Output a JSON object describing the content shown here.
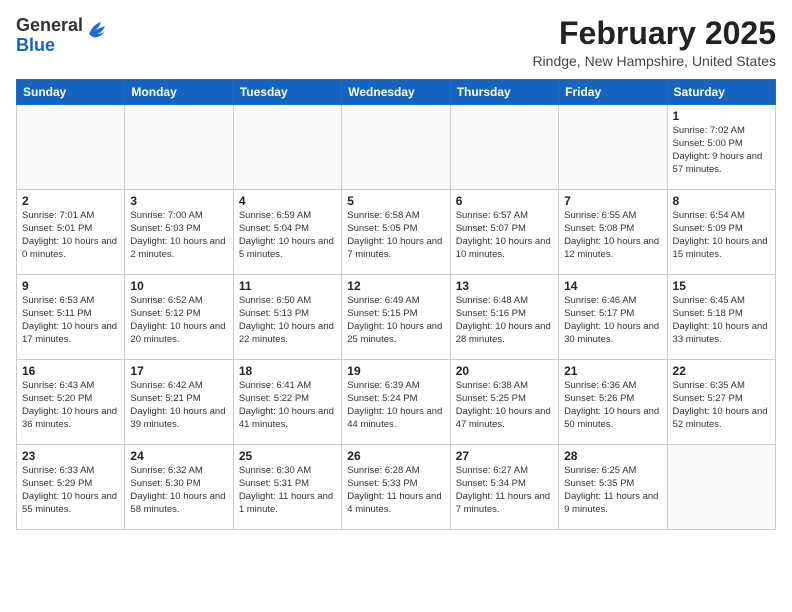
{
  "header": {
    "logo_general": "General",
    "logo_blue": "Blue",
    "month_year": "February 2025",
    "location": "Rindge, New Hampshire, United States"
  },
  "calendar": {
    "days_of_week": [
      "Sunday",
      "Monday",
      "Tuesday",
      "Wednesday",
      "Thursday",
      "Friday",
      "Saturday"
    ],
    "weeks": [
      [
        {
          "day": "",
          "info": ""
        },
        {
          "day": "",
          "info": ""
        },
        {
          "day": "",
          "info": ""
        },
        {
          "day": "",
          "info": ""
        },
        {
          "day": "",
          "info": ""
        },
        {
          "day": "",
          "info": ""
        },
        {
          "day": "1",
          "info": "Sunrise: 7:02 AM\nSunset: 5:00 PM\nDaylight: 9 hours and 57 minutes."
        }
      ],
      [
        {
          "day": "2",
          "info": "Sunrise: 7:01 AM\nSunset: 5:01 PM\nDaylight: 10 hours and 0 minutes."
        },
        {
          "day": "3",
          "info": "Sunrise: 7:00 AM\nSunset: 5:03 PM\nDaylight: 10 hours and 2 minutes."
        },
        {
          "day": "4",
          "info": "Sunrise: 6:59 AM\nSunset: 5:04 PM\nDaylight: 10 hours and 5 minutes."
        },
        {
          "day": "5",
          "info": "Sunrise: 6:58 AM\nSunset: 5:05 PM\nDaylight: 10 hours and 7 minutes."
        },
        {
          "day": "6",
          "info": "Sunrise: 6:57 AM\nSunset: 5:07 PM\nDaylight: 10 hours and 10 minutes."
        },
        {
          "day": "7",
          "info": "Sunrise: 6:55 AM\nSunset: 5:08 PM\nDaylight: 10 hours and 12 minutes."
        },
        {
          "day": "8",
          "info": "Sunrise: 6:54 AM\nSunset: 5:09 PM\nDaylight: 10 hours and 15 minutes."
        }
      ],
      [
        {
          "day": "9",
          "info": "Sunrise: 6:53 AM\nSunset: 5:11 PM\nDaylight: 10 hours and 17 minutes."
        },
        {
          "day": "10",
          "info": "Sunrise: 6:52 AM\nSunset: 5:12 PM\nDaylight: 10 hours and 20 minutes."
        },
        {
          "day": "11",
          "info": "Sunrise: 6:50 AM\nSunset: 5:13 PM\nDaylight: 10 hours and 22 minutes."
        },
        {
          "day": "12",
          "info": "Sunrise: 6:49 AM\nSunset: 5:15 PM\nDaylight: 10 hours and 25 minutes."
        },
        {
          "day": "13",
          "info": "Sunrise: 6:48 AM\nSunset: 5:16 PM\nDaylight: 10 hours and 28 minutes."
        },
        {
          "day": "14",
          "info": "Sunrise: 6:46 AM\nSunset: 5:17 PM\nDaylight: 10 hours and 30 minutes."
        },
        {
          "day": "15",
          "info": "Sunrise: 6:45 AM\nSunset: 5:18 PM\nDaylight: 10 hours and 33 minutes."
        }
      ],
      [
        {
          "day": "16",
          "info": "Sunrise: 6:43 AM\nSunset: 5:20 PM\nDaylight: 10 hours and 36 minutes."
        },
        {
          "day": "17",
          "info": "Sunrise: 6:42 AM\nSunset: 5:21 PM\nDaylight: 10 hours and 39 minutes."
        },
        {
          "day": "18",
          "info": "Sunrise: 6:41 AM\nSunset: 5:22 PM\nDaylight: 10 hours and 41 minutes."
        },
        {
          "day": "19",
          "info": "Sunrise: 6:39 AM\nSunset: 5:24 PM\nDaylight: 10 hours and 44 minutes."
        },
        {
          "day": "20",
          "info": "Sunrise: 6:38 AM\nSunset: 5:25 PM\nDaylight: 10 hours and 47 minutes."
        },
        {
          "day": "21",
          "info": "Sunrise: 6:36 AM\nSunset: 5:26 PM\nDaylight: 10 hours and 50 minutes."
        },
        {
          "day": "22",
          "info": "Sunrise: 6:35 AM\nSunset: 5:27 PM\nDaylight: 10 hours and 52 minutes."
        }
      ],
      [
        {
          "day": "23",
          "info": "Sunrise: 6:33 AM\nSunset: 5:29 PM\nDaylight: 10 hours and 55 minutes."
        },
        {
          "day": "24",
          "info": "Sunrise: 6:32 AM\nSunset: 5:30 PM\nDaylight: 10 hours and 58 minutes."
        },
        {
          "day": "25",
          "info": "Sunrise: 6:30 AM\nSunset: 5:31 PM\nDaylight: 11 hours and 1 minute."
        },
        {
          "day": "26",
          "info": "Sunrise: 6:28 AM\nSunset: 5:33 PM\nDaylight: 11 hours and 4 minutes."
        },
        {
          "day": "27",
          "info": "Sunrise: 6:27 AM\nSunset: 5:34 PM\nDaylight: 11 hours and 7 minutes."
        },
        {
          "day": "28",
          "info": "Sunrise: 6:25 AM\nSunset: 5:35 PM\nDaylight: 11 hours and 9 minutes."
        },
        {
          "day": "",
          "info": ""
        }
      ]
    ]
  }
}
